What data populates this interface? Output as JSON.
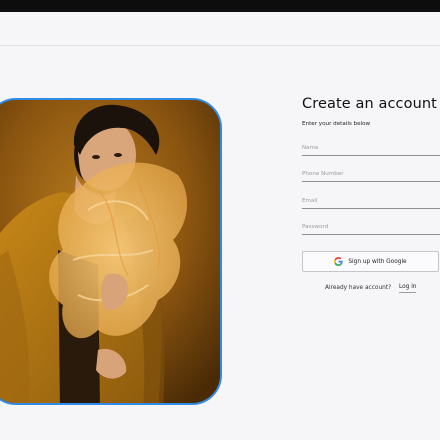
{
  "signup": {
    "title": "Create an account",
    "subtitle": "Enter your details below",
    "fields": [
      {
        "placeholder": "Name",
        "value": ""
      },
      {
        "placeholder": "Phone Number",
        "value": ""
      },
      {
        "placeholder": "Email",
        "value": ""
      },
      {
        "placeholder": "Password",
        "value": ""
      }
    ],
    "google_button_label": "Sign up with Google",
    "google_icon": "google-g-logo",
    "login_prompt": "Already have account?",
    "login_link": "Log in"
  },
  "hero_image": {
    "description_icon": "portrait-photo",
    "frame_color": "#2f8be6"
  },
  "colors": {
    "top_bar": "#0d0d0d",
    "background": "#f6f6f9",
    "field_underline": "#8e8e94"
  }
}
